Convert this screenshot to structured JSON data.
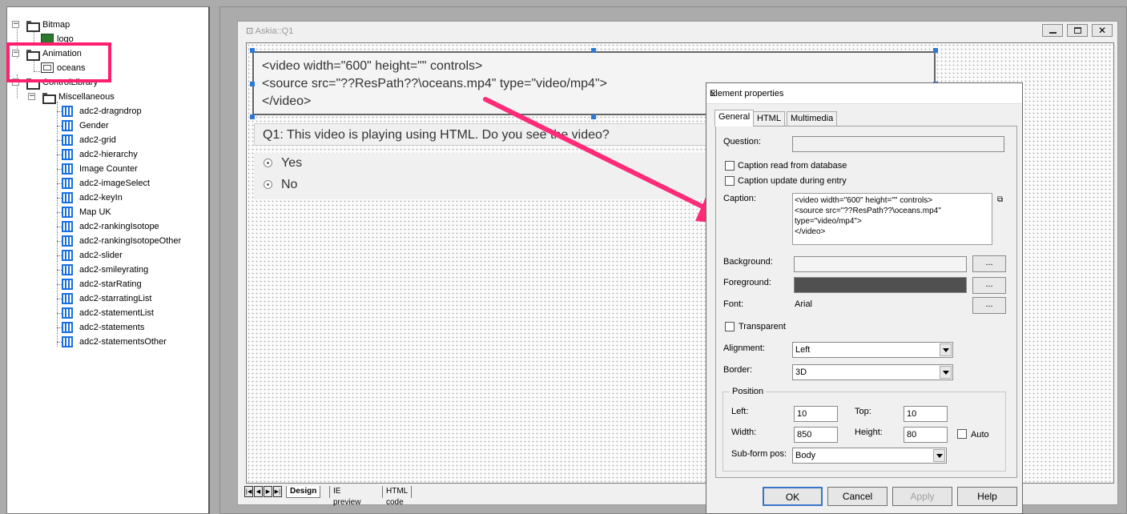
{
  "tree": {
    "bitmap": "Bitmap",
    "logo": "logo",
    "animation": "Animation",
    "oceans": "oceans",
    "controlLibrary": "ControlLibrary",
    "miscellaneous": "Miscellaneous",
    "items": [
      "adc2-dragndrop",
      "Gender",
      "adc2-grid",
      "adc2-hierarchy",
      "Image Counter",
      "adc2-imageSelect",
      "adc2-keyIn",
      "Map UK",
      "adc2-rankingIsotope",
      "adc2-rankingIsotopeOther",
      "adc2-slider",
      "adc2-smileyrating",
      "adc2-starRating",
      "adc2-starratingList",
      "adc2-statementList",
      "adc2-statements",
      "adc2-statementsOther"
    ]
  },
  "window": {
    "title": "Askia::Q1"
  },
  "design": {
    "html_line1": "<video width=\"600\" height=\"\" controls>",
    "html_line2": "<source src=\"??ResPath??\\oceans.mp4\" type=\"video/mp4\">",
    "html_line3": "</video>",
    "question": "Q1: This video is playing using HTML. Do you see the video?",
    "option_yes": "Yes",
    "option_no": "No"
  },
  "bottom_tabs": [
    "Design",
    "IE preview",
    "HTML code"
  ],
  "dialog": {
    "title": "Element properties",
    "tabs": [
      "General",
      "HTML",
      "Multimedia"
    ],
    "question_label": "Question:",
    "cb_caption_db": "Caption read from database",
    "cb_caption_update": "Caption update during entry",
    "caption_label": "Caption:",
    "caption_text": "<video width=\"600\" height=\"\" controls>\n<source src=\"??ResPath??\\oceans.mp4\" type=\"video/mp4\">\n</video>",
    "background_label": "Background:",
    "foreground_label": "Foreground:",
    "font_label": "Font:",
    "font_value": "Arial",
    "dots": "...",
    "transparent_label": "Transparent",
    "alignment_label": "Alignment:",
    "alignment_value": "Left",
    "border_label": "Border:",
    "border_value": "3D",
    "position_label": "Position",
    "left_label": "Left:",
    "left_value": "10",
    "top_label": "Top:",
    "top_value": "10",
    "width_label": "Width:",
    "width_value": "850",
    "height_label": "Height:",
    "height_value": "80",
    "auto_label": "Auto",
    "subform_label": "Sub-form pos:",
    "subform_value": "Body",
    "ok": "OK",
    "cancel": "Cancel",
    "apply": "Apply",
    "help": "Help",
    "foreground_color": "#505050"
  },
  "colors": {
    "highlight": "#ff1f6e",
    "arrow": "#ff2a78",
    "control_icon": "#1a6fe0",
    "handle": "#2b78d6"
  }
}
